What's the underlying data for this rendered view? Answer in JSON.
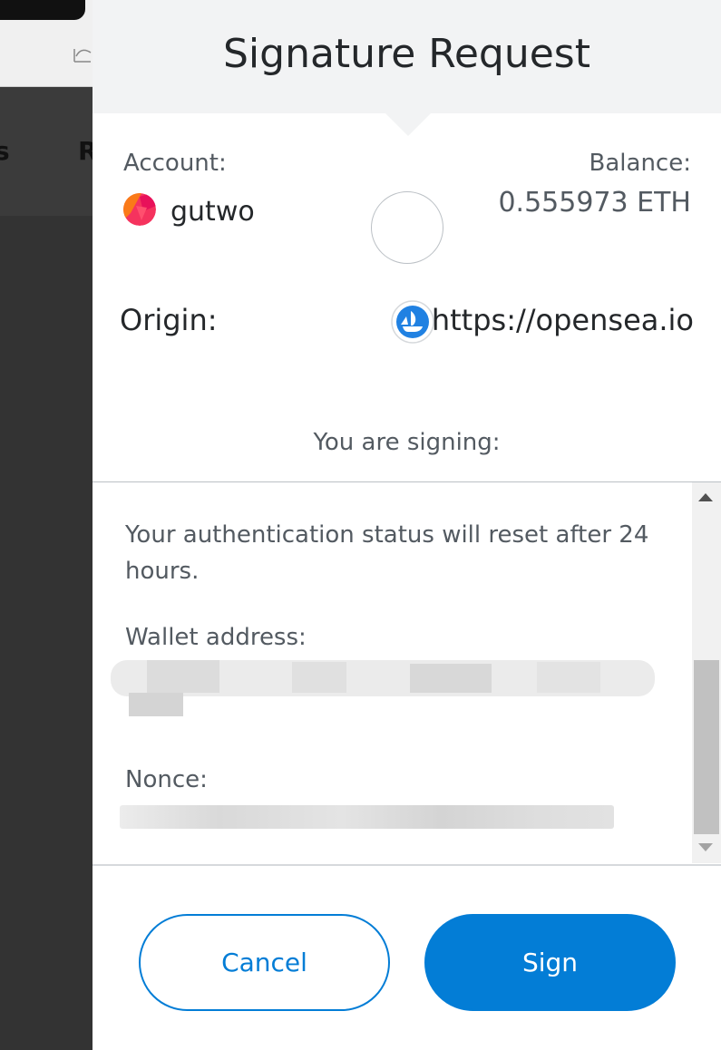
{
  "background": {
    "nav_fragments": [
      "s",
      "R"
    ]
  },
  "header": {
    "title": "Signature Request"
  },
  "account": {
    "label": "Account:",
    "name": "gutwo"
  },
  "balance": {
    "label": "Balance:",
    "value": "0.555973 ETH"
  },
  "origin": {
    "label": "Origin:",
    "url": "https://opensea.io",
    "icon": "opensea-icon"
  },
  "signing": {
    "label": "You are signing:"
  },
  "message": {
    "text": "Your authentication status will reset after 24 hours.",
    "wallet_label": "Wallet address:",
    "nonce_label": "Nonce:"
  },
  "buttons": {
    "cancel": "Cancel",
    "sign": "Sign"
  },
  "colors": {
    "accent": "#037dd6",
    "header_bg": "#f2f3f4",
    "text_muted": "#535a61"
  }
}
